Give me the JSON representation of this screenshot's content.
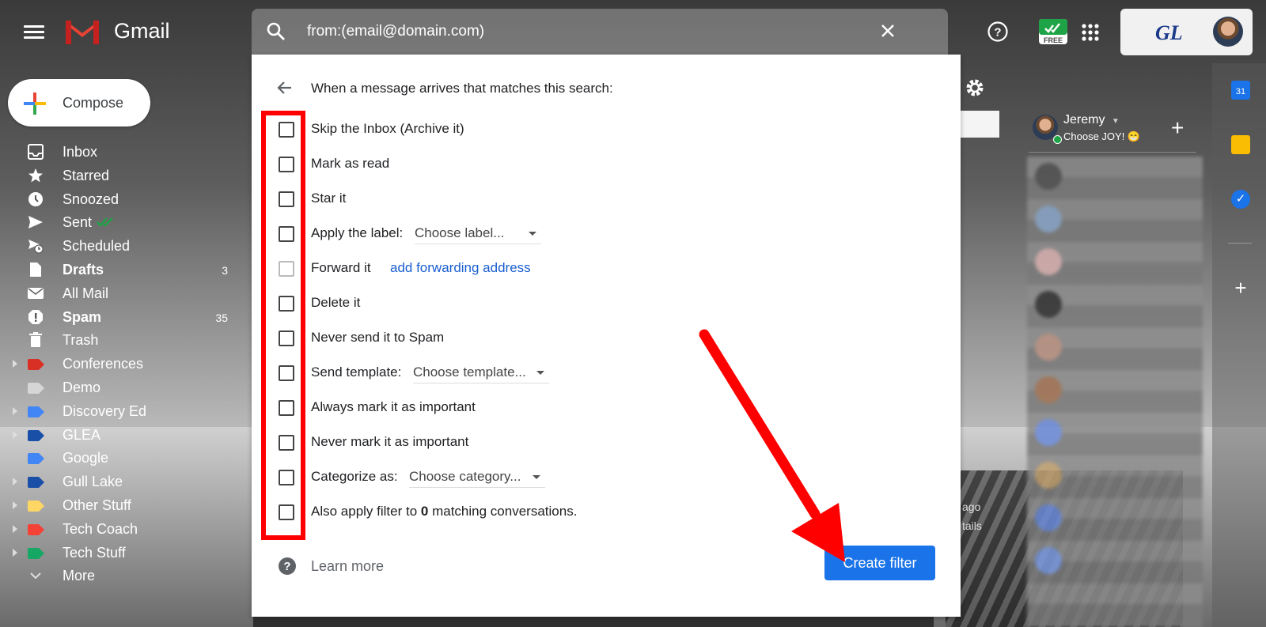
{
  "app": {
    "name": "Gmail"
  },
  "search": {
    "query": "from:(email@domain.com)"
  },
  "topbar": {
    "extension_badge": "FREE",
    "account_logo": "GL"
  },
  "compose": {
    "label": "Compose"
  },
  "nav": {
    "items": [
      {
        "label": "Inbox",
        "icon": "inbox-icon",
        "bold": false,
        "count": ""
      },
      {
        "label": "Starred",
        "icon": "star-icon",
        "bold": false,
        "count": ""
      },
      {
        "label": "Snoozed",
        "icon": "clock-icon",
        "bold": false,
        "count": ""
      },
      {
        "label": "Sent",
        "icon": "send-icon",
        "bold": false,
        "count": ""
      },
      {
        "label": "Scheduled",
        "icon": "scheduled-icon",
        "bold": false,
        "count": ""
      },
      {
        "label": "Drafts",
        "icon": "draft-icon",
        "bold": true,
        "count": "3"
      },
      {
        "label": "All Mail",
        "icon": "mail-icon",
        "bold": false,
        "count": ""
      },
      {
        "label": "Spam",
        "icon": "spam-icon",
        "bold": true,
        "count": "35"
      },
      {
        "label": "Trash",
        "icon": "trash-icon",
        "bold": false,
        "count": ""
      },
      {
        "label": "Conferences",
        "icon": "label-icon",
        "color": "#d93025",
        "expandable": true
      },
      {
        "label": "Demo",
        "icon": "label-icon",
        "color": "#d6d6d6",
        "expandable": false
      },
      {
        "label": "Discovery Ed",
        "icon": "label-icon",
        "color": "#4285f4",
        "expandable": true
      },
      {
        "label": "GLEA",
        "icon": "label-icon",
        "color": "#1a4fa8",
        "expandable": true
      },
      {
        "label": "Google",
        "icon": "label-icon",
        "color": "#4285f4",
        "expandable": false
      },
      {
        "label": "Gull Lake",
        "icon": "label-icon",
        "color": "#1a4fa8",
        "expandable": true
      },
      {
        "label": "Other Stuff",
        "icon": "label-icon",
        "color": "#fdd663",
        "expandable": true
      },
      {
        "label": "Tech Coach",
        "icon": "label-icon",
        "color": "#f44336",
        "expandable": true
      },
      {
        "label": "Tech Stuff",
        "icon": "label-icon",
        "color": "#16a765",
        "expandable": true
      },
      {
        "label": "More",
        "icon": "chevron-down-icon",
        "expandable": false
      }
    ]
  },
  "filter": {
    "title": "When a message arrives that matches this search:",
    "options": [
      {
        "label": "Skip the Inbox (Archive it)"
      },
      {
        "label": "Mark as read"
      },
      {
        "label": "Star it"
      },
      {
        "label": "Apply the label:",
        "dropdown": "Choose label..."
      },
      {
        "label": "Forward it",
        "link": "add forwarding address"
      },
      {
        "label": "Delete it"
      },
      {
        "label": "Never send it to Spam"
      },
      {
        "label": "Send template:",
        "dropdown": "Choose template..."
      },
      {
        "label": "Always mark it as important"
      },
      {
        "label": "Never mark it as important"
      },
      {
        "label": "Categorize as:",
        "dropdown": "Choose category..."
      },
      {
        "label_pre": "Also apply filter to ",
        "label_bold": "0",
        "label_post": " matching conversations."
      }
    ],
    "learn_more": "Learn more",
    "create_button": "Create filter"
  },
  "chat": {
    "name": "Jeremy",
    "status": "Choose JOY! 😁"
  },
  "background": {
    "ago": "ago",
    "tails": "tails"
  },
  "side_panel": {
    "calendar_day": "31"
  },
  "colors": {
    "accent": "#1a73e8",
    "annotation": "#ff0000"
  }
}
